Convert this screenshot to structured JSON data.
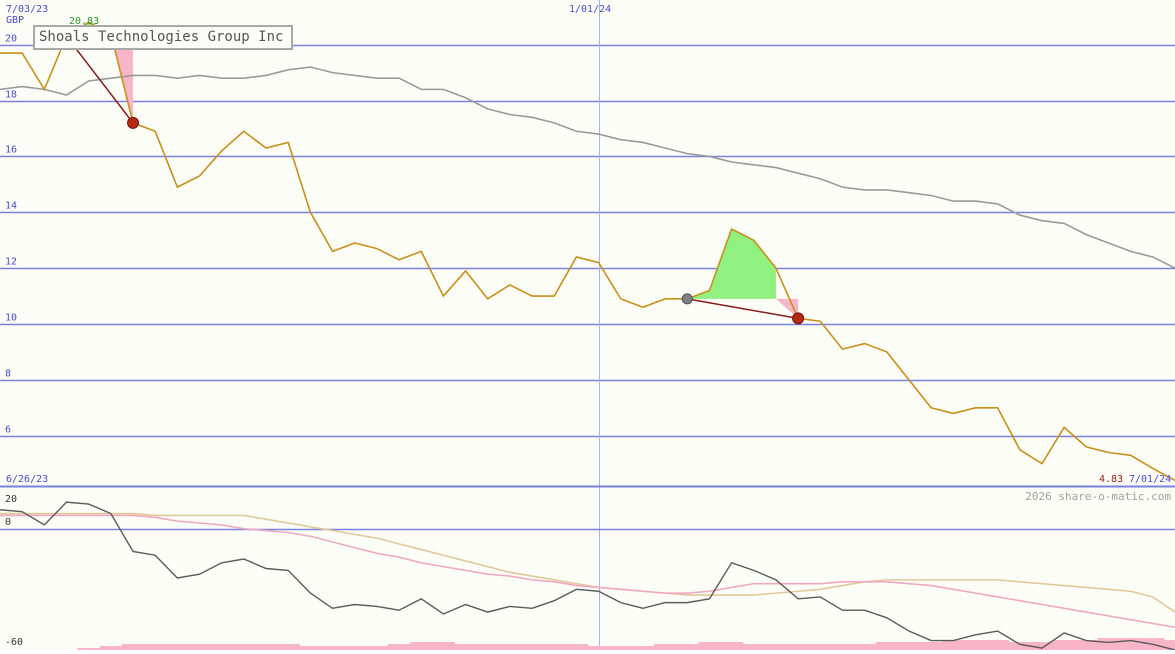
{
  "company_title": "Shoals Technologies Group Inc",
  "currency": "GBP",
  "watermark": "2026 share-o-matic.com",
  "dates": {
    "main_start": "7/03/23",
    "main_mid": "1/01/24",
    "main_end": "7/01/24",
    "lower_start": "6/26/23"
  },
  "colors": {
    "background": "#fdfdf7",
    "grid": "#7a80e0",
    "price_line": "#c8901a",
    "moving_average": "#9a9a9a",
    "gain_fill": "#90f080",
    "loss_fill": "#f8b4c8",
    "trend_line": "#8a1a1a",
    "marker_low": "#b82a10",
    "marker_start": "#808080",
    "osc_line": "#5a5a5a",
    "osc_pink": "#f0a8c0",
    "osc_tan": "#e0c89a",
    "volume": "#f8b4c8"
  },
  "chart_data": [
    {
      "type": "line",
      "title": "Shoals Technologies Group Inc",
      "ylabel": "GBP",
      "ylim": [
        4.2,
        21.6
      ],
      "yticks": [
        6,
        8,
        10,
        12,
        14,
        16,
        18,
        20
      ],
      "grid": true,
      "x_tick_labels": [
        "7/03/23",
        "1/01/24",
        "7/01/24"
      ],
      "annotations": {
        "high": "20.83",
        "last": "4.83"
      },
      "x": [
        "2023-06-26",
        "2023-07-03",
        "2023-07-10",
        "2023-07-17",
        "2023-07-24",
        "2023-07-31",
        "2023-08-07",
        "2023-08-14",
        "2023-08-21",
        "2023-08-28",
        "2023-09-04",
        "2023-09-11",
        "2023-09-18",
        "2023-09-25",
        "2023-10-02",
        "2023-10-09",
        "2023-10-16",
        "2023-10-23",
        "2023-10-30",
        "2023-11-06",
        "2023-11-13",
        "2023-11-20",
        "2023-11-27",
        "2023-12-04",
        "2023-12-11",
        "2023-12-18",
        "2023-12-25",
        "2024-01-01",
        "2024-01-08",
        "2024-01-15",
        "2024-01-22",
        "2024-01-29",
        "2024-02-05",
        "2024-02-12",
        "2024-02-19",
        "2024-02-26",
        "2024-03-04",
        "2024-03-11",
        "2024-03-18",
        "2024-03-25",
        "2024-04-01",
        "2024-04-08",
        "2024-04-15",
        "2024-04-22",
        "2024-04-29",
        "2024-05-06",
        "2024-05-13",
        "2024-05-20",
        "2024-05-27",
        "2024-06-03",
        "2024-06-10",
        "2024-06-17",
        "2024-06-24",
        "2024-07-01"
      ],
      "series": [
        {
          "name": "price",
          "values": [
            19.7,
            19.7,
            18.4,
            20.3,
            20.8,
            20.4,
            17.2,
            16.9,
            14.9,
            15.3,
            16.2,
            16.9,
            16.3,
            16.5,
            14.0,
            12.6,
            12.9,
            12.7,
            12.3,
            12.6,
            11.0,
            11.9,
            10.9,
            11.4,
            11.0,
            11.0,
            12.4,
            12.2,
            10.9,
            10.6,
            10.9,
            10.9,
            11.2,
            13.4,
            13.0,
            12.0,
            10.2,
            10.1,
            9.1,
            9.3,
            9.0,
            8.0,
            7.0,
            6.8,
            7.0,
            7.0,
            5.5,
            5.0,
            6.3,
            5.6,
            5.4,
            5.3,
            4.83,
            4.4
          ]
        },
        {
          "name": "moving average",
          "values": [
            18.4,
            18.5,
            18.4,
            18.2,
            18.7,
            18.8,
            18.9,
            18.9,
            18.8,
            18.9,
            18.8,
            18.8,
            18.9,
            19.1,
            19.2,
            19.0,
            18.9,
            18.8,
            18.8,
            18.4,
            18.4,
            18.1,
            17.7,
            17.5,
            17.4,
            17.2,
            16.9,
            16.8,
            16.6,
            16.5,
            16.3,
            16.1,
            16.0,
            15.8,
            15.7,
            15.6,
            15.4,
            15.2,
            14.9,
            14.8,
            14.8,
            14.7,
            14.6,
            14.4,
            14.4,
            14.3,
            13.9,
            13.7,
            13.6,
            13.2,
            12.9,
            12.6,
            12.4,
            12.0
          ]
        }
      ]
    },
    {
      "type": "line",
      "ylim": [
        -64,
        22
      ],
      "yticks": [
        20,
        0,
        -60
      ],
      "grid": true,
      "x_tick_labels": [
        "6/26/23"
      ],
      "series": [
        {
          "name": "oscillator",
          "values": [
            10,
            9,
            2,
            14,
            13,
            8,
            -12,
            -14,
            -26,
            -24,
            -18,
            -16,
            -21,
            -22,
            -34,
            -42,
            -40,
            -41,
            -43,
            -37,
            -45,
            -40,
            -44,
            -41,
            -42,
            -38,
            -32,
            -33,
            -39,
            -42,
            -39,
            -39,
            -37,
            -18,
            -22,
            -27,
            -37,
            -36,
            -43,
            -43,
            -47,
            -54,
            -59,
            -59,
            -56,
            -54,
            -61,
            -63,
            -55,
            -59,
            -60,
            -59,
            -61,
            -64
          ]
        },
        {
          "name": "signal pink",
          "values": [
            7,
            7,
            7,
            7,
            7,
            7,
            7,
            6,
            4,
            3,
            2,
            0,
            -1,
            -2,
            -4,
            -7,
            -10,
            -13,
            -15,
            -18,
            -20,
            -22,
            -24,
            -25,
            -27,
            -28,
            -30,
            -31,
            -32,
            -33,
            -34,
            -34,
            -33,
            -31,
            -29,
            -29,
            -29,
            -29,
            -28,
            -28,
            -28,
            -29,
            -30,
            -32,
            -34,
            -36,
            -38,
            -40,
            -42,
            -44,
            -46,
            -48,
            -50,
            -52
          ]
        },
        {
          "name": "signal tan",
          "values": [
            8,
            8,
            8,
            8,
            8,
            8,
            8,
            7,
            7,
            7,
            7,
            7,
            5,
            3,
            1,
            -1,
            -3,
            -5,
            -8,
            -11,
            -14,
            -17,
            -20,
            -23,
            -25,
            -27,
            -29,
            -31,
            -32,
            -33,
            -34,
            -35,
            -35,
            -35,
            -35,
            -34,
            -33,
            -32,
            -30,
            -28,
            -27,
            -27,
            -27,
            -27,
            -27,
            -27,
            -28,
            -29,
            -30,
            -31,
            -32,
            -33,
            -36,
            -44
          ]
        },
        {
          "name": "volume",
          "values": [
            0,
            0,
            0,
            0,
            1,
            2,
            3,
            3,
            3,
            3,
            3,
            3,
            3,
            3,
            2,
            2,
            2,
            2,
            3,
            4,
            4,
            3,
            3,
            3,
            3,
            3,
            3,
            2,
            2,
            2,
            3,
            3,
            4,
            4,
            3,
            3,
            3,
            3,
            3,
            3,
            4,
            4,
            4,
            5,
            5,
            5,
            4,
            4,
            5,
            5,
            6,
            6,
            6,
            5
          ]
        }
      ]
    }
  ]
}
